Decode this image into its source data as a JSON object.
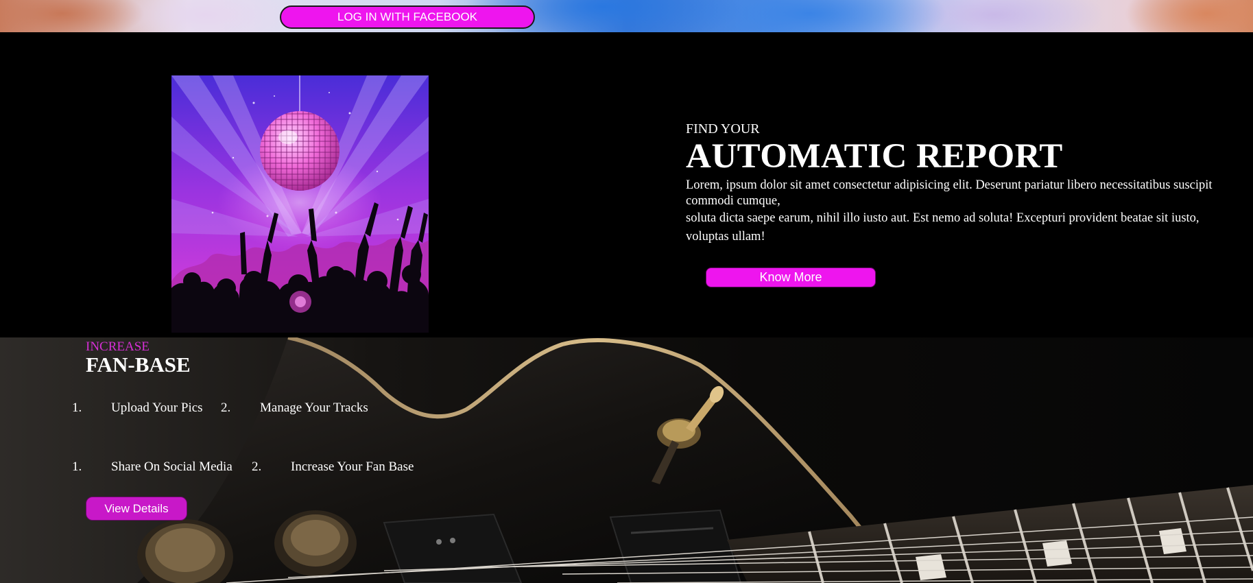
{
  "header": {
    "facebook_login_label": "LOG IN WITH FACEBOOK"
  },
  "hero": {
    "kicker": "FIND YOUR",
    "title": "AUTOMATIC REPORT",
    "paragraph_line1": "Lorem, ipsum dolor sit amet consectetur adipisicing elit. Deserunt pariatur libero necessitatibus suscipit commodi cumque,",
    "paragraph_line2": "soluta dicta saepe earum, nihil illo iusto aut. Est nemo ad soluta! Excepturi provident beatae sit iusto, voluptas ullam!",
    "know_more_label": "Know More"
  },
  "fan_base": {
    "kicker": "INCREASE",
    "title": "FAN-BASE",
    "rows": [
      [
        {
          "number": "1.",
          "label": "Upload Your Pics"
        },
        {
          "number": "2.",
          "label": "Manage Your Tracks"
        }
      ],
      [
        {
          "number": "1.",
          "label": "Share On Social Media"
        },
        {
          "number": "2.",
          "label": "Increase Your Fan Base"
        }
      ]
    ],
    "view_details_label": "View Details"
  },
  "colors": {
    "accent_magenta": "#ee15ee",
    "accent_purple": "#c818c8",
    "kicker_magenta": "#d62fd6",
    "background": "#000000"
  }
}
